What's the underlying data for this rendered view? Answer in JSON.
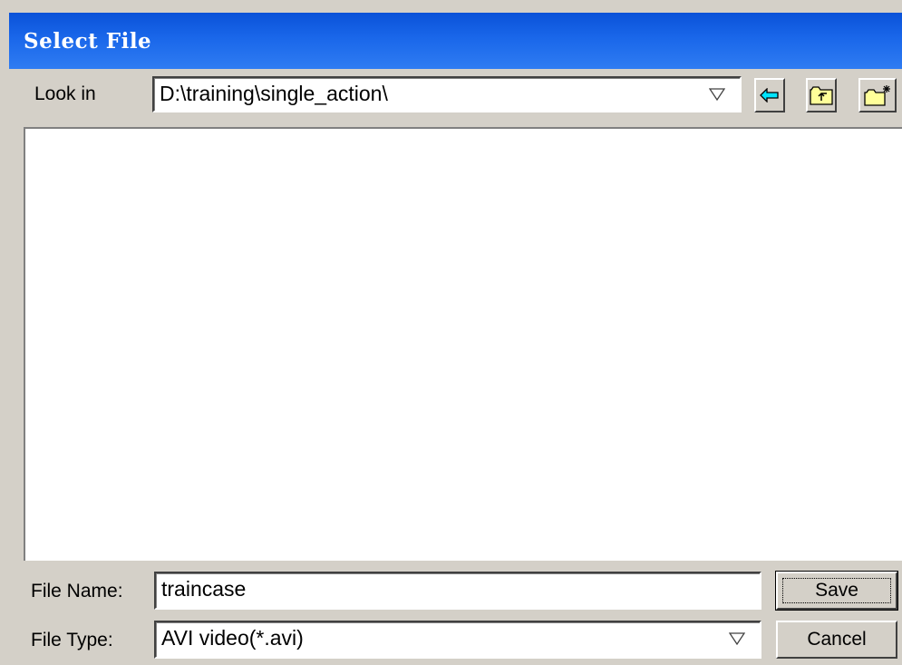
{
  "window": {
    "title": "Select File"
  },
  "look_in": {
    "label": "Look in",
    "value": "D:\\training\\single_action\\"
  },
  "toolbar": {
    "back_icon": "back-arrow-icon",
    "up_icon": "up-folder-icon",
    "new_folder_icon": "new-folder-icon"
  },
  "file_name": {
    "label": "File Name:",
    "value": "traincase"
  },
  "file_type": {
    "label": "File Type:",
    "value": "AVI video(*.avi)"
  },
  "buttons": {
    "save_label": "Save",
    "cancel_label": "Cancel"
  },
  "colors": {
    "titlebar": "#1a67ea",
    "dialog_bg": "#d4d0c8",
    "back_arrow": "#00e5ff",
    "folder_fill": "#ffff99"
  }
}
